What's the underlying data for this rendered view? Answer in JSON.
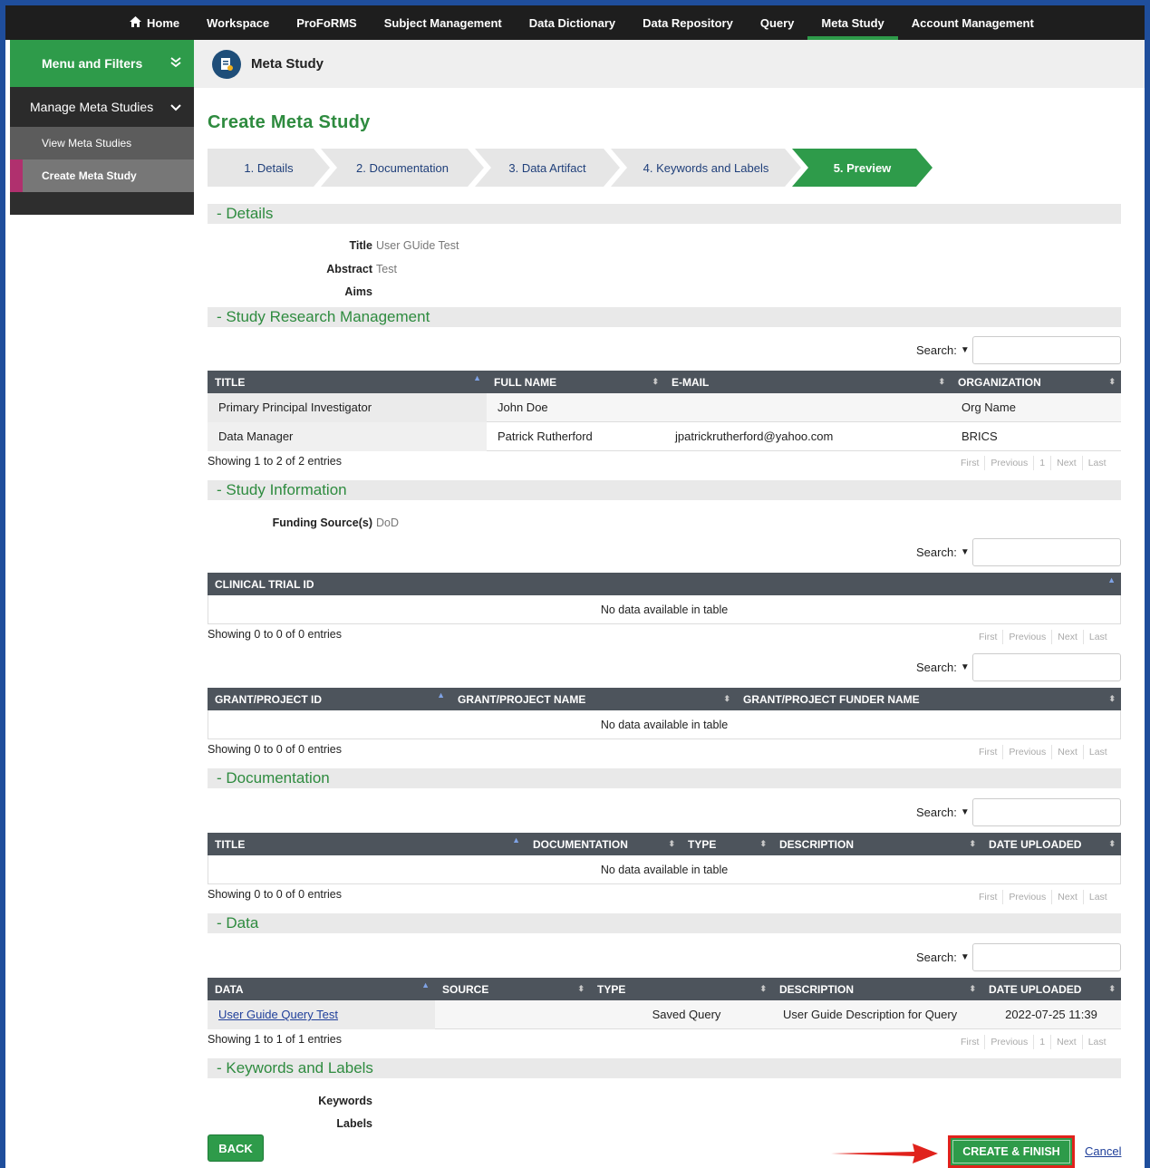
{
  "topnav": {
    "items": [
      "Home",
      "Workspace",
      "ProFoRMS",
      "Subject Management",
      "Data Dictionary",
      "Data Repository",
      "Query",
      "Meta Study",
      "Account Management"
    ]
  },
  "sidebar": {
    "header": "Menu and Filters",
    "section": "Manage Meta Studies",
    "links": [
      "View Meta Studies",
      "Create Meta Study"
    ]
  },
  "pagebar": {
    "title": "Meta Study"
  },
  "page_title": "Create Meta Study",
  "steps": [
    "1. Details",
    "2. Documentation",
    "3. Data Artifact",
    "4. Keywords and Labels",
    "5. Preview"
  ],
  "details": {
    "header": "- Details",
    "title_label": "Title",
    "title_value": "User GUide Test",
    "abstract_label": "Abstract",
    "abstract_value": "Test",
    "aims_label": "Aims"
  },
  "search_label": "Search:",
  "srm": {
    "header": "- Study Research Management",
    "columns": [
      "TITLE",
      "FULL NAME",
      "E-MAIL",
      "ORGANIZATION"
    ],
    "rows": [
      [
        "Primary Principal Investigator",
        "John Doe",
        "",
        "Org Name"
      ],
      [
        "Data Manager",
        "Patrick Rutherford",
        "jpatrickrutherford@yahoo.com",
        "BRICS"
      ]
    ],
    "info": "Showing 1 to 2 of 2 entries"
  },
  "pager": {
    "first": "First",
    "previous": "Previous",
    "page": "1",
    "next": "Next",
    "last": "Last"
  },
  "study_info": {
    "header": "- Study Information",
    "funding_label": "Funding Source(s)",
    "funding_value": "DoD",
    "clinical": {
      "columns": [
        "CLINICAL TRIAL ID"
      ],
      "empty": "No data available in table",
      "info": "Showing 0 to 0 of 0 entries"
    },
    "grant": {
      "columns": [
        "GRANT/PROJECT ID",
        "GRANT/PROJECT NAME",
        "GRANT/PROJECT FUNDER NAME"
      ],
      "empty": "No data available in table",
      "info": "Showing 0 to 0 of 0 entries"
    }
  },
  "documentation": {
    "header": "- Documentation",
    "columns": [
      "TITLE",
      "DOCUMENTATION",
      "TYPE",
      "DESCRIPTION",
      "DATE UPLOADED"
    ],
    "empty": "No data available in table",
    "info": "Showing 0 to 0 of 0 entries"
  },
  "data": {
    "header": "- Data",
    "columns": [
      "DATA",
      "SOURCE",
      "TYPE",
      "DESCRIPTION",
      "DATE UPLOADED"
    ],
    "rows": [
      [
        "User Guide Query Test",
        "",
        "Saved Query",
        "User Guide Description for Query",
        "2022-07-25 11:39"
      ]
    ],
    "info": "Showing 1 to 1 of 1 entries"
  },
  "keywords": {
    "header": "- Keywords and Labels",
    "keywords_label": "Keywords",
    "labels_label": "Labels"
  },
  "buttons": {
    "back": "BACK",
    "create": "CREATE & FINISH",
    "cancel": "Cancel"
  },
  "colors": {
    "accent_green": "#2e9b4a",
    "nav_dark": "#1e1e1e",
    "highlight_red": "#e0221c",
    "frame_blue": "#1f4e9c"
  }
}
